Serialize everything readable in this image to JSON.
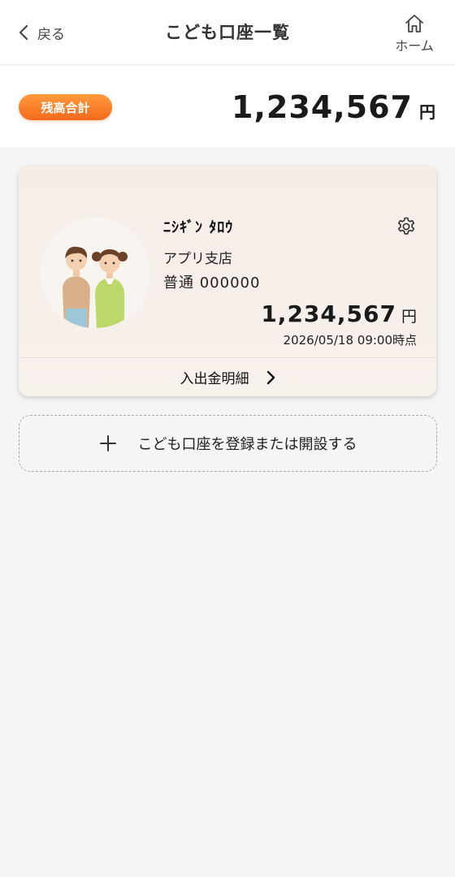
{
  "header": {
    "back_label": "戻る",
    "title": "こども口座一覧",
    "home_label": "ホーム"
  },
  "balance": {
    "badge_label": "残高合計",
    "amount": "1,234,567",
    "unit": "円"
  },
  "account_card": {
    "name": "ﾆｼｷﾞﾝ ﾀﾛｳ",
    "branch": "アプリ支店",
    "account_number": "普通 000000",
    "amount": "1,234,567",
    "unit": "円",
    "timestamp": "2026/05/18 09:00時点",
    "detail_label": "入出金明細"
  },
  "add_account": {
    "label": "こども口座を登録または開設する"
  },
  "icons": {
    "back": "chevron-left-icon",
    "home": "home-icon",
    "settings": "gear-icon",
    "detail": "chevron-right-icon",
    "add": "plus-icon"
  },
  "colors": {
    "accent": "#f5691c",
    "card_background": "#f6ede6",
    "page_background": "#f5f5f5"
  }
}
